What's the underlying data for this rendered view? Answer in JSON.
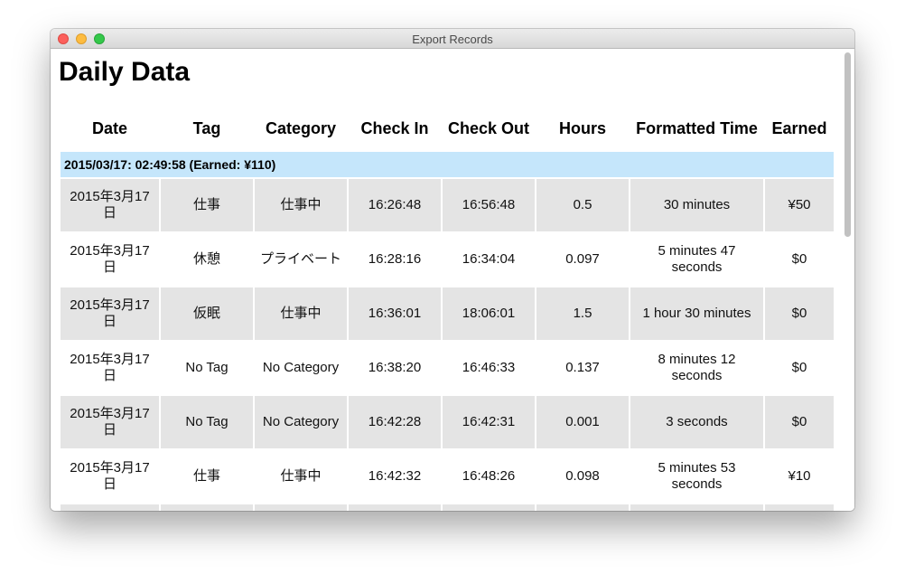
{
  "window": {
    "title": "Export Records"
  },
  "page": {
    "title": "Daily Data"
  },
  "table": {
    "headers": [
      "Date",
      "Tag",
      "Category",
      "Check In",
      "Check Out",
      "Hours",
      "Formatted Time",
      "Earned"
    ],
    "group": {
      "label": "2015/03/17: 02:49:58 (Earned: ¥110)"
    },
    "rows": [
      [
        "2015年3月17日",
        "仕事",
        "仕事中",
        "16:26:48",
        "16:56:48",
        "0.5",
        "30 minutes",
        "¥50"
      ],
      [
        "2015年3月17日",
        "休憩",
        "プライベート",
        "16:28:16",
        "16:34:04",
        "0.097",
        "5 minutes 47 seconds",
        "$0"
      ],
      [
        "2015年3月17日",
        "仮眠",
        "仕事中",
        "16:36:01",
        "18:06:01",
        "1.5",
        "1 hour 30 minutes",
        "$0"
      ],
      [
        "2015年3月17日",
        "No Tag",
        "No Category",
        "16:38:20",
        "16:46:33",
        "0.137",
        "8 minutes 12 seconds",
        "$0"
      ],
      [
        "2015年3月17日",
        "No Tag",
        "No Category",
        "16:42:28",
        "16:42:31",
        "0.001",
        "3 seconds",
        "$0"
      ],
      [
        "2015年3月17日",
        "仕事",
        "仕事中",
        "16:42:32",
        "16:48:26",
        "0.098",
        "5 minutes 53 seconds",
        "¥10"
      ],
      [
        "",
        "",
        "",
        "",
        "",
        "",
        "",
        ""
      ]
    ]
  }
}
